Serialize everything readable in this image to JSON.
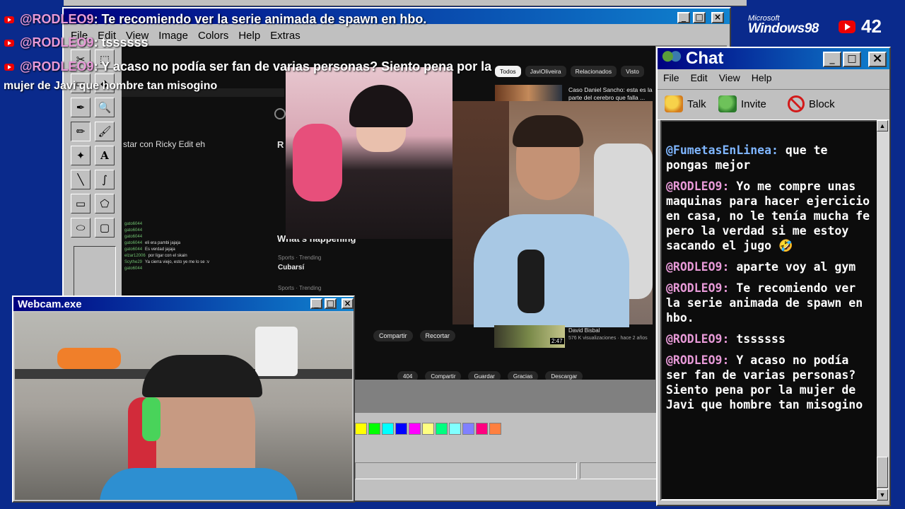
{
  "brand": {
    "microsoft": "Microsoft",
    "windows": "Windows98"
  },
  "youtube_count": "42",
  "overlay": {
    "lines": [
      {
        "user": "@RODLEO9",
        "text": ": Te recomiendo ver la serie animada de spawn en hbo."
      },
      {
        "user": "@RODLEO9",
        "text": ": tssssss"
      },
      {
        "user": "@RODLEO9",
        "text": ": Y acaso no podía ser fan de varias personas? Siento pena por la"
      }
    ],
    "wrap": "mujer de Javi que hombre tan misogino"
  },
  "paint": {
    "menu": [
      "File",
      "Edit",
      "View",
      "Image",
      "Colors",
      "Help",
      "Extras"
    ],
    "colors": [
      "#ffff00",
      "#00ff00",
      "#00ffff",
      "#0000ff",
      "#ff00ff",
      "#ffff80",
      "#00ff80",
      "#80ffff",
      "#8080ff",
      "#ff0080",
      "#ff8040"
    ]
  },
  "inner_video": {
    "side_chat": [
      {
        "user": "gato6044",
        "text": ""
      },
      {
        "user": "gato6044",
        "text": ""
      },
      {
        "user": "gato6044",
        "text": ""
      },
      {
        "user": "gato6044",
        "text": "eli era pambi jajaja"
      },
      {
        "user": "gato6044",
        "text": "Es verdad jajaja"
      },
      {
        "user": "elzar12006",
        "text": "por ligar con el skain"
      },
      {
        "user": "Scythe29",
        "text": "Ya cierra viejo, esto ye me lo se :v"
      },
      {
        "user": "gato6044",
        "text": ""
      }
    ],
    "snippet": "star con Ricky Edit eh",
    "whats_happening": "What's happening",
    "trend1_meta": "Sports · Trending",
    "trend1": "Cubarsí",
    "trend2_meta": "Sports · Trending",
    "chips": [
      "Todos",
      "JaviOliveira",
      "Relacionados",
      "Visto"
    ],
    "rec_title": "Caso Daniel Sancho: esta es la parte del cerebro que falla ...",
    "actions1": [
      "Compartir",
      "Recortar"
    ],
    "channel": "David Bisbal",
    "channel_meta": "576 K visualizaciones · hace 2 años",
    "duration": "2:47",
    "likes": "404",
    "actions2": [
      "Compartir",
      "Guardar",
      "Gracias",
      "Descargar"
    ]
  },
  "webcam": {
    "title": "Webcam.exe"
  },
  "chat": {
    "title": "Chat",
    "menu": [
      "File",
      "Edit",
      "View",
      "Help"
    ],
    "tools": [
      {
        "icon": "talk-icon",
        "label": "Talk"
      },
      {
        "icon": "invite-icon",
        "label": "Invite"
      },
      {
        "icon": "block-icon",
        "label": "Block"
      }
    ],
    "messages": [
      {
        "user": "@FumetasEnLinea:",
        "text": "que te pongas mejor",
        "color": "#7fb6ff"
      },
      {
        "user": "@RODLEO9:",
        "text": "Yo me compre unas maquinas para hacer ejercicio en casa, no le tenía mucha fe pero la verdad si me estoy sacando el jugo 🤣",
        "color": "#e89ad8"
      },
      {
        "user": "@RODLEO9:",
        "text": "aparte voy al gym",
        "color": "#e89ad8"
      },
      {
        "user": "@RODLEO9:",
        "text": "Te recomiendo ver la serie animada de spawn en hbo.",
        "color": "#e89ad8"
      },
      {
        "user": "@RODLEO9:",
        "text": "tssssss",
        "color": "#e89ad8"
      },
      {
        "user": "@RODLEO9:",
        "text": "Y acaso no podía ser fan de varias personas? Siento pena por la mujer de Javi que hombre tan misogino",
        "color": "#e89ad8"
      }
    ]
  }
}
